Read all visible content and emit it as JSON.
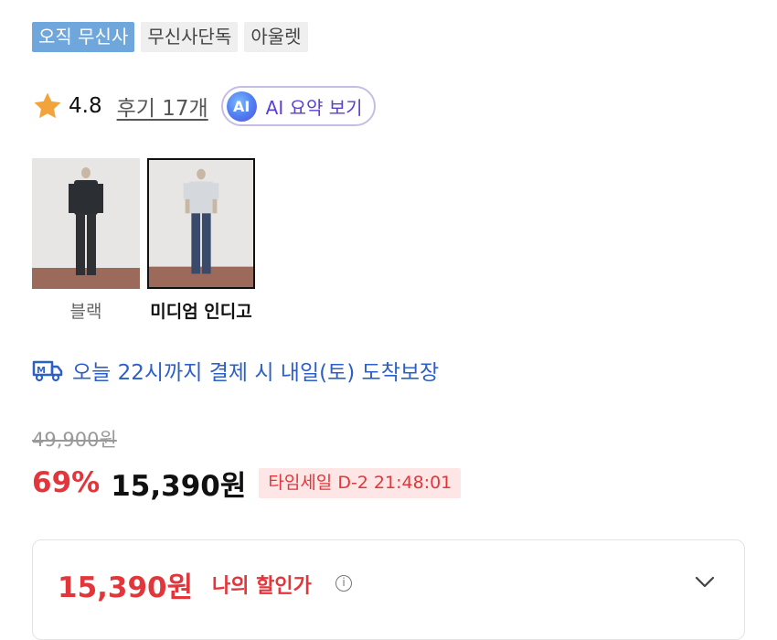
{
  "tags": [
    {
      "label": "오직 무신사",
      "primary": true
    },
    {
      "label": "무신사단독",
      "primary": false
    },
    {
      "label": "아울렛",
      "primary": false
    }
  ],
  "rating": {
    "score": "4.8",
    "review_link": "후기 17개",
    "ai_badge": "AI",
    "ai_button": "AI 요약 보기",
    "star_color": "#f2a33a"
  },
  "colors": [
    {
      "label": "블랙",
      "selected": false,
      "shirt_color": "#2b2f34",
      "pants_color": "#2e3034"
    },
    {
      "label": "미디엄 인디고",
      "selected": true,
      "shirt_color": "#d5d9de",
      "pants_color": "#3a4a6a"
    }
  ],
  "delivery": {
    "icon": "delivery-truck-icon",
    "text": "오늘 22시까지 결제 시 내일(토) 도착보장",
    "color": "#2d5fc8"
  },
  "price": {
    "original": "49,900원",
    "discount_rate": "69%",
    "sale": "15,390원",
    "timesale": "타임세일 D-2 21:48:01",
    "accent": "#e2363b"
  },
  "my_discount": {
    "price": "15,390원",
    "label": "나의 할인가",
    "info_icon": "i"
  }
}
